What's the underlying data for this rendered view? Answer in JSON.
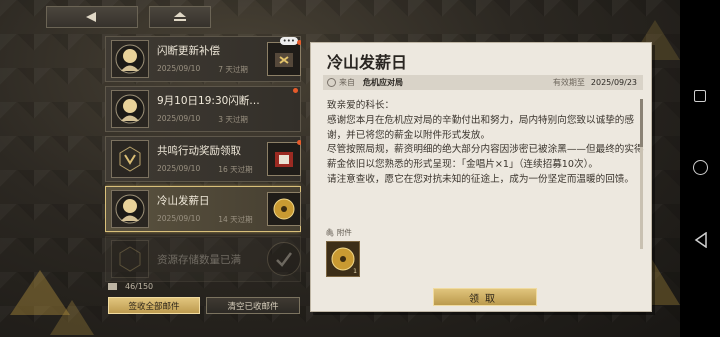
{
  "colors": {
    "accent_gold": "#d9bd74",
    "unread_dot": "#e65a2a",
    "panel_paper": "#ede8df"
  },
  "topbar": {
    "back_icon": "back-arrow-icon",
    "home_icon": "home-icon"
  },
  "mail_list": [
    {
      "title": "闪断更新补偿",
      "date": "2025/09/10",
      "expiry": "7 天过期",
      "avatar": "character-avatar",
      "unread": true,
      "thumb": "supply-box-icon",
      "badge": "•••"
    },
    {
      "title": "9月10日19:30闪断…",
      "date": "2025/09/10",
      "expiry": "3 天过期",
      "avatar": "character-avatar",
      "unread": true
    },
    {
      "title": "共鸣行动奖励领取",
      "date": "2025/09/10",
      "expiry": "16 天过期",
      "avatar": "emblem-avatar",
      "unread": true,
      "thumb": "red-box-icon"
    },
    {
      "title": "冷山发薪日",
      "date": "2025/09/10",
      "expiry": "14 天过期",
      "avatar": "character-avatar",
      "selected": true,
      "thumb": "gold-record-icon"
    },
    {
      "title": "资源存储数量已满",
      "avatar": "emblem-avatar",
      "faded": true,
      "thumb": "check-icon"
    }
  ],
  "mail_count": "46/150",
  "buttons": {
    "claim_all": "签收全部邮件",
    "clear_received": "清空已收邮件",
    "claim": "领取"
  },
  "detail": {
    "title": "冷山发薪日",
    "from_label": "来自",
    "sender": "危机应对局",
    "expiry_label": "有效期至",
    "expiry_date": "2025/09/23",
    "body": "致亲爱的科长：\n感谢您本月在危机应对局的辛勤付出和努力，局内特别向您致以诚挚的感谢，并已将您的薪金以附件形式发放。\n尽管按照局规，薪资明细的绝大部分内容因涉密已被涂黑——但最终的实得薪金依旧以您熟悉的形式呈现：「金唱片×1」（连续招募10次）。\n请注意查收，愿它在您对抗未知的征途上，成为一份坚定而温暖的回馈。",
    "attachment_label": "附件",
    "attachment_qty": "1",
    "attachment_icon": "gold-record-icon"
  }
}
